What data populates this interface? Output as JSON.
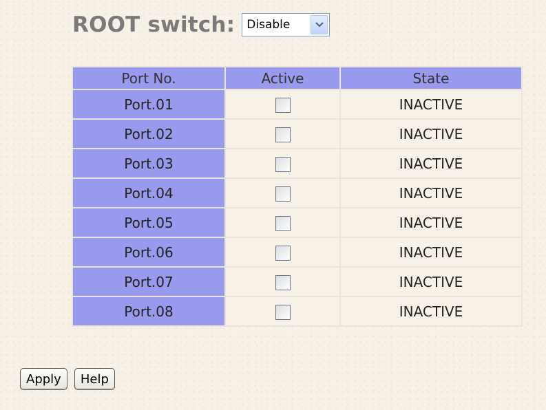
{
  "root_switch": {
    "label": "ROOT switch:",
    "selected": "Disable"
  },
  "table": {
    "headers": {
      "port": "Port No.",
      "active": "Active",
      "state": "State"
    },
    "rows": [
      {
        "port": "Port.01",
        "active": false,
        "state": "INACTIVE"
      },
      {
        "port": "Port.02",
        "active": false,
        "state": "INACTIVE"
      },
      {
        "port": "Port.03",
        "active": false,
        "state": "INACTIVE"
      },
      {
        "port": "Port.04",
        "active": false,
        "state": "INACTIVE"
      },
      {
        "port": "Port.05",
        "active": false,
        "state": "INACTIVE"
      },
      {
        "port": "Port.06",
        "active": false,
        "state": "INACTIVE"
      },
      {
        "port": "Port.07",
        "active": false,
        "state": "INACTIVE"
      },
      {
        "port": "Port.08",
        "active": false,
        "state": "INACTIVE"
      }
    ]
  },
  "buttons": {
    "apply": "Apply",
    "help": "Help"
  },
  "colors": {
    "header_bg": "#9999ee",
    "page_bg": "#f7f1e8"
  },
  "icons": {
    "dropdown": "chevron-down-icon"
  }
}
